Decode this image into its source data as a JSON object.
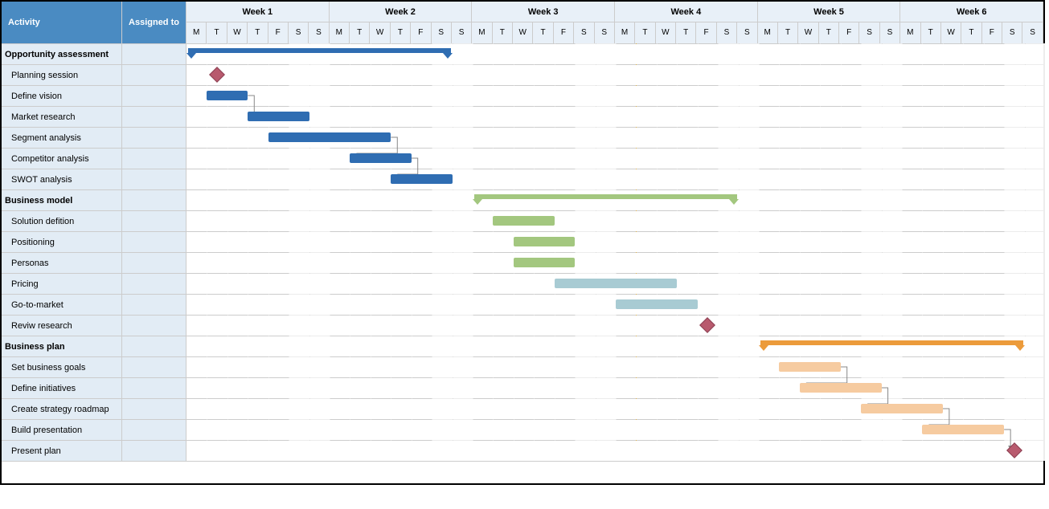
{
  "columns": {
    "activity": "Activity",
    "assigned": "Assigned to"
  },
  "weeks": [
    "Week 1",
    "Week 2",
    "Week 3",
    "Week 4",
    "Week 5",
    "Week 6"
  ],
  "days": [
    "M",
    "T",
    "W",
    "T",
    "F",
    "S",
    "S",
    "M",
    "T",
    "W",
    "T",
    "F",
    "S",
    "S",
    "M",
    "T",
    "W",
    "T",
    "F",
    "S",
    "S",
    "M",
    "T",
    "W",
    "T",
    "F",
    "S",
    "S",
    "M",
    "T",
    "W",
    "T",
    "F",
    "S",
    "S",
    "M",
    "T",
    "W",
    "T",
    "F",
    "S",
    "S"
  ],
  "colors": {
    "blue": "#2f6db2",
    "green": "#a3c77f",
    "teal": "#a8cbd3",
    "orange_summary": "#ec9b3b",
    "orange_bar": "#f6cba0",
    "milestone": "#b85a6e",
    "today": "#e8b84a"
  },
  "today_day": 22,
  "chart_data": {
    "type": "gantt",
    "unit": "day",
    "weekend_days": [
      5,
      6,
      12,
      13,
      19,
      20,
      26,
      27,
      33,
      34,
      40,
      41
    ],
    "rows": [
      {
        "id": "opp",
        "label": "Opportunity assessment",
        "type": "summary",
        "color": "blue",
        "start": 0,
        "end": 13
      },
      {
        "id": "plan",
        "label": "Planning session",
        "type": "milestone",
        "day": 1,
        "parent": "opp"
      },
      {
        "id": "vision",
        "label": "Define vision",
        "type": "bar",
        "color": "blue",
        "start": 1,
        "end": 3,
        "parent": "opp",
        "dep_to": "market"
      },
      {
        "id": "market",
        "label": "Market research",
        "type": "bar",
        "color": "blue",
        "start": 3,
        "end": 6,
        "parent": "opp"
      },
      {
        "id": "segment",
        "label": "Segment analysis",
        "type": "bar",
        "color": "blue",
        "start": 4,
        "end": 10,
        "parent": "opp",
        "dep_to": "comp"
      },
      {
        "id": "comp",
        "label": "Competitor analysis",
        "type": "bar",
        "color": "blue",
        "start": 8,
        "end": 11,
        "parent": "opp",
        "dep_to": "swot"
      },
      {
        "id": "swot",
        "label": "SWOT analysis",
        "type": "bar",
        "color": "blue",
        "start": 10,
        "end": 13,
        "parent": "opp"
      },
      {
        "id": "bm",
        "label": "Business model",
        "type": "summary",
        "color": "green",
        "start": 14,
        "end": 27
      },
      {
        "id": "sol",
        "label": "Solution defition",
        "type": "bar",
        "color": "green",
        "start": 15,
        "end": 18,
        "parent": "bm"
      },
      {
        "id": "pos",
        "label": "Positioning",
        "type": "bar",
        "color": "green",
        "start": 16,
        "end": 19,
        "parent": "bm"
      },
      {
        "id": "pers",
        "label": "Personas",
        "type": "bar",
        "color": "green",
        "start": 16,
        "end": 19,
        "parent": "bm"
      },
      {
        "id": "price",
        "label": "Pricing",
        "type": "bar",
        "color": "teal",
        "start": 18,
        "end": 24,
        "parent": "bm"
      },
      {
        "id": "gtm",
        "label": "Go-to-market",
        "type": "bar",
        "color": "teal",
        "start": 21,
        "end": 25,
        "parent": "bm"
      },
      {
        "id": "rev",
        "label": "Reviw research",
        "type": "milestone",
        "day": 25,
        "parent": "bm"
      },
      {
        "id": "bp",
        "label": "Business plan",
        "type": "summary",
        "color": "orange",
        "start": 28,
        "end": 41
      },
      {
        "id": "goals",
        "label": "Set business goals",
        "type": "bar",
        "color": "orange",
        "start": 29,
        "end": 32,
        "parent": "bp",
        "dep_to": "init"
      },
      {
        "id": "init",
        "label": "Define initiatives",
        "type": "bar",
        "color": "orange",
        "start": 30,
        "end": 34,
        "parent": "bp",
        "dep_to": "road"
      },
      {
        "id": "road",
        "label": "Create strategy roadmap",
        "type": "bar",
        "color": "orange",
        "start": 33,
        "end": 37,
        "parent": "bp",
        "dep_to": "pres"
      },
      {
        "id": "pres",
        "label": "Build presentation",
        "type": "bar",
        "color": "orange",
        "start": 36,
        "end": 40,
        "parent": "bp",
        "dep_to": "pplan"
      },
      {
        "id": "pplan",
        "label": "Present plan",
        "type": "milestone",
        "day": 40,
        "parent": "bp"
      }
    ]
  }
}
